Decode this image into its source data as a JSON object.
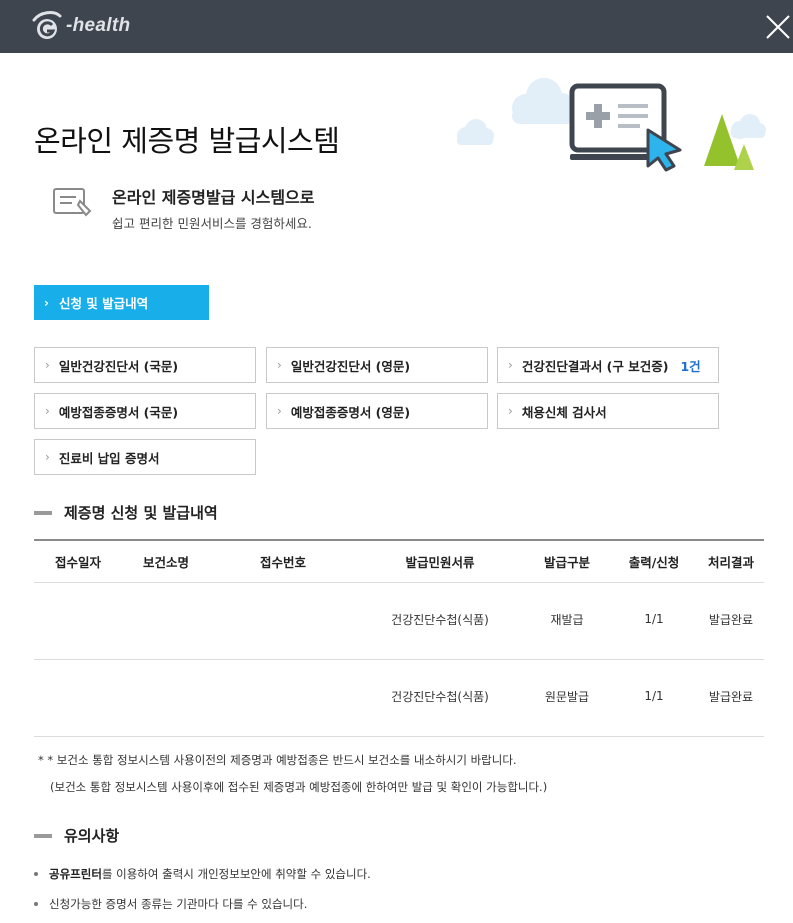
{
  "header": {
    "logo_text": "-health"
  },
  "page_title": "온라인 제증명 발급시스템",
  "intro": {
    "heading": "온라인 제증명발급 시스템으로",
    "sub": "쉽고 편리한 민원서비스를 경험하세요."
  },
  "primary_button": {
    "label": "신청 및 발급내역"
  },
  "doc_buttons": [
    {
      "label": "일반건강진단서 (국문)",
      "count": ""
    },
    {
      "label": "일반건강진단서 (영문)",
      "count": ""
    },
    {
      "label": "건강진단결과서 (구 보건증)",
      "count": "1건"
    },
    {
      "label": "예방접종증명서 (국문)",
      "count": ""
    },
    {
      "label": "예방접종증명서 (영문)",
      "count": ""
    },
    {
      "label": "채용신체 검사서",
      "count": ""
    },
    {
      "label": "진료비 납입 증명서",
      "count": ""
    }
  ],
  "history_section": {
    "title": "제증명 신청 및 발급내역"
  },
  "table": {
    "headers": [
      "접수일자",
      "보건소명",
      "접수번호",
      "발급민원서류",
      "발급구분",
      "출력/신청",
      "처리결과"
    ],
    "rows": [
      [
        "",
        "",
        "",
        "건강진단수첩(식품)",
        "재발급",
        "1/1",
        "발급완료"
      ],
      [
        "",
        "",
        "",
        "건강진단수첩(식품)",
        "원문발급",
        "1/1",
        "발급완료"
      ]
    ]
  },
  "notes": {
    "line1": "* * 보건소 통합 정보시스템 사용이전의 제증명과 예방접종은 반드시 보건소를 내소하시기 바랍니다.",
    "line2": "(보건소 통합 정보시스템 사용이후에 접수된 제증명과 예방접종에 한하여만 발급 및 확인이 가능합니다.)"
  },
  "caution_section": {
    "title": "유의사항"
  },
  "cautions": [
    {
      "bold": "공유프린터",
      "rest": "를 이용하여 출력시 개인정보보안에 취약할 수 있습니다."
    },
    {
      "bold": "",
      "rest": "신청가능한 증명서 종류는 기관마다 다를 수 있습니다."
    }
  ],
  "colors": {
    "topbar": "#3f454e",
    "accent": "#17aee9",
    "count": "#1e6fcf"
  }
}
